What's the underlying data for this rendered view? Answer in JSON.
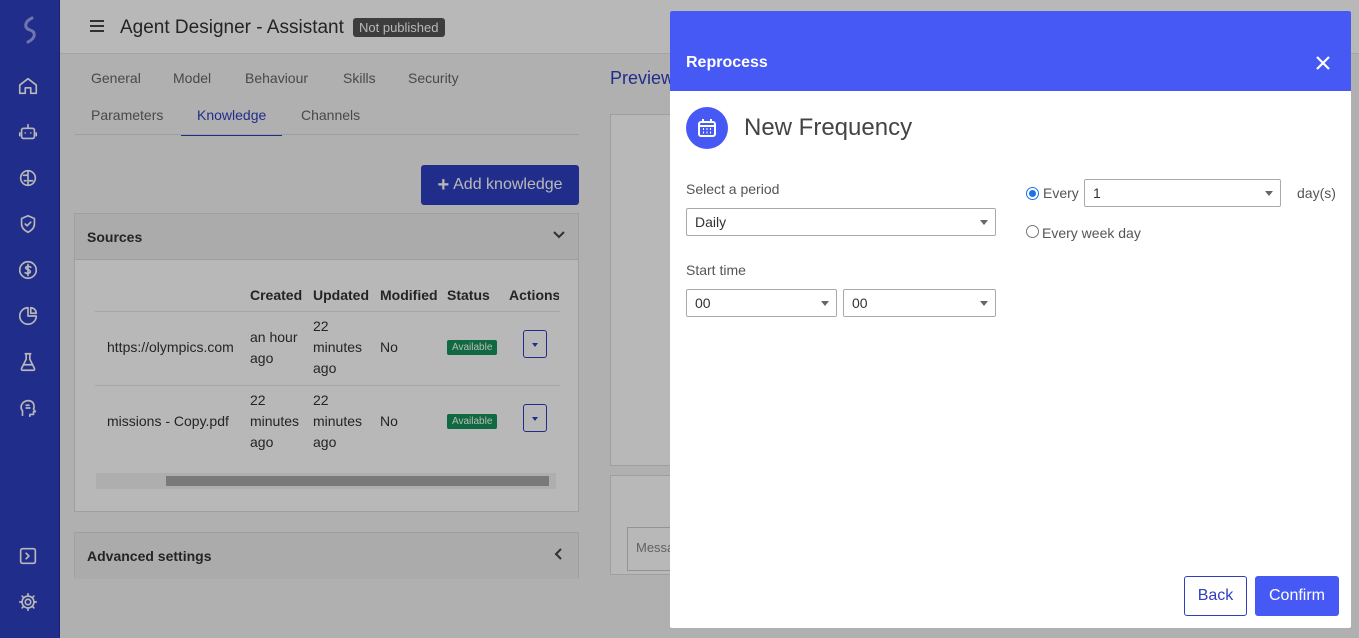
{
  "header": {
    "title": "Agent Designer - Assistant",
    "badge": "Not published"
  },
  "tabs": {
    "row1": [
      "General",
      "Model",
      "Behaviour",
      "Skills",
      "Security"
    ],
    "row2": [
      "Parameters",
      "Knowledge",
      "Channels"
    ],
    "active": "Knowledge"
  },
  "add_knowledge_label": "Add knowledge",
  "sources": {
    "title": "Sources",
    "columns": [
      "Created",
      "Updated",
      "Modified",
      "Status",
      "Actions"
    ],
    "rows": [
      {
        "name": "https://olympics.com",
        "created": "an hour ago",
        "updated": "22 minutes ago",
        "modified": "No",
        "status": "Available"
      },
      {
        "name": "missions - Copy.pdf",
        "created": "22 minutes ago",
        "updated": "22 minutes ago",
        "modified": "No",
        "status": "Available"
      }
    ]
  },
  "advanced_settings": "Advanced settings",
  "preview": {
    "title": "Preview",
    "message_placeholder": "Messa"
  },
  "modal": {
    "header": "Reprocess",
    "title": "New Frequency",
    "period_label": "Select a period",
    "period_value": "Daily",
    "start_label": "Start time",
    "hour_value": "00",
    "minute_value": "00",
    "every_label": "Every",
    "every_value": "1",
    "unit_label": "day(s)",
    "weekday_label": "Every week day",
    "back_label": "Back",
    "confirm_label": "Confirm"
  },
  "colors": {
    "sidebar": "#2f3fc0",
    "modal_header": "#4659f5",
    "available": "#15935a"
  }
}
